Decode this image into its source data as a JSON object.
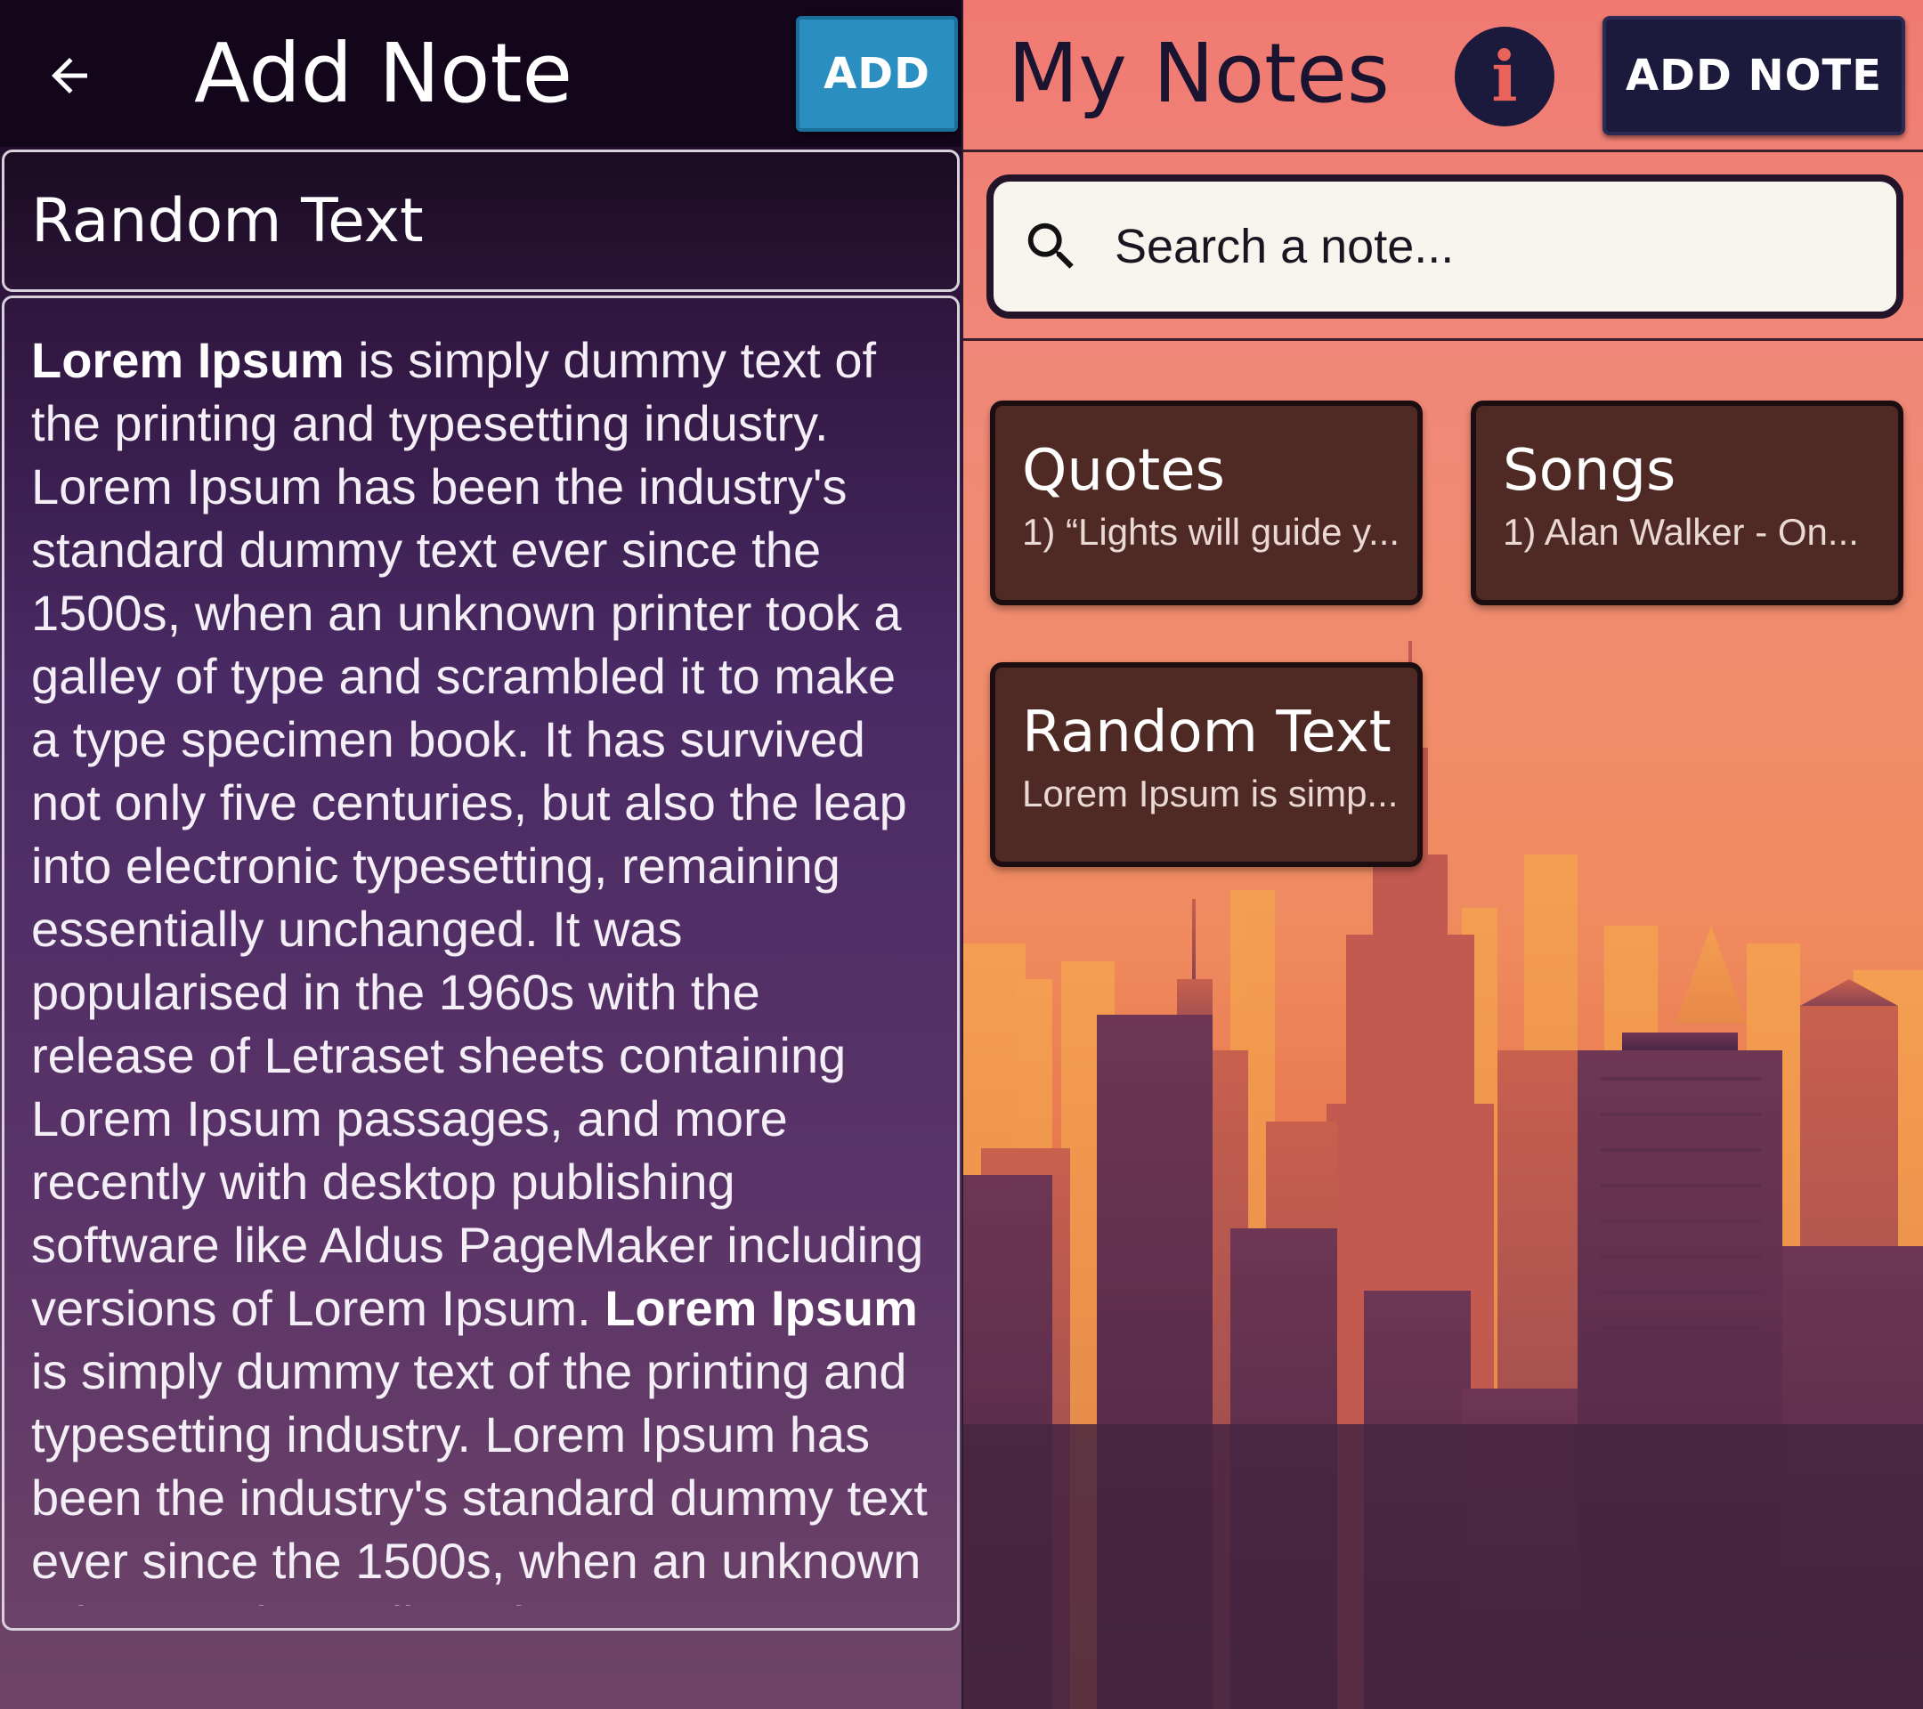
{
  "add_note_screen": {
    "title": "Add Note",
    "back_icon": "arrow-left-icon",
    "add_button_label": "ADD",
    "note_title_value": "Random Text",
    "note_body_emphasis": "Lorem Ipsum",
    "note_body_rest": " is simply dummy text of the printing and typesetting industry. Lorem Ipsum has been the industry's standard dummy text ever since the 1500s, when an unknown printer took a galley of type and scrambled it to make a type specimen book. It has survived not only five centuries, but also the leap into electronic typesetting, remaining essentially unchanged. It was popularised in the 1960s with the release of Letraset sheets containing Lorem Ipsum passages, and more recently with desktop publishing software like Aldus PageMaker including versions of Lorem Ipsum.",
    "note_body_emphasis_2": "Lorem Ipsum",
    "note_body_rest_2": " is simply dummy text of the printing and typesetting industry. Lorem Ipsum has been the industry's standard dummy text ever since the 1500s, when an unknown printer took a galley of type"
  },
  "my_notes_screen": {
    "title": "My Notes",
    "info_icon": "info-icon",
    "info_glyph": "i",
    "add_note_button_label": "ADD NOTE",
    "search_placeholder": "Search a note...",
    "search_icon": "search-icon",
    "notes": [
      {
        "title": "Quotes",
        "preview": "1) “Lights will guide y..."
      },
      {
        "title": "Songs",
        "preview": "1) Alan Walker - On..."
      },
      {
        "title": "Random Text",
        "preview": "Lorem Ipsum is simp..."
      }
    ]
  },
  "colors": {
    "left_bg_top": "#13061a",
    "left_bg_bottom": "#6e4468",
    "add_button": "#2a8fc0",
    "right_bg_top": "#f07a72",
    "navy_button": "#1b1a3c",
    "note_card": "#4f2a24",
    "search_bg": "#f8f5ee"
  }
}
